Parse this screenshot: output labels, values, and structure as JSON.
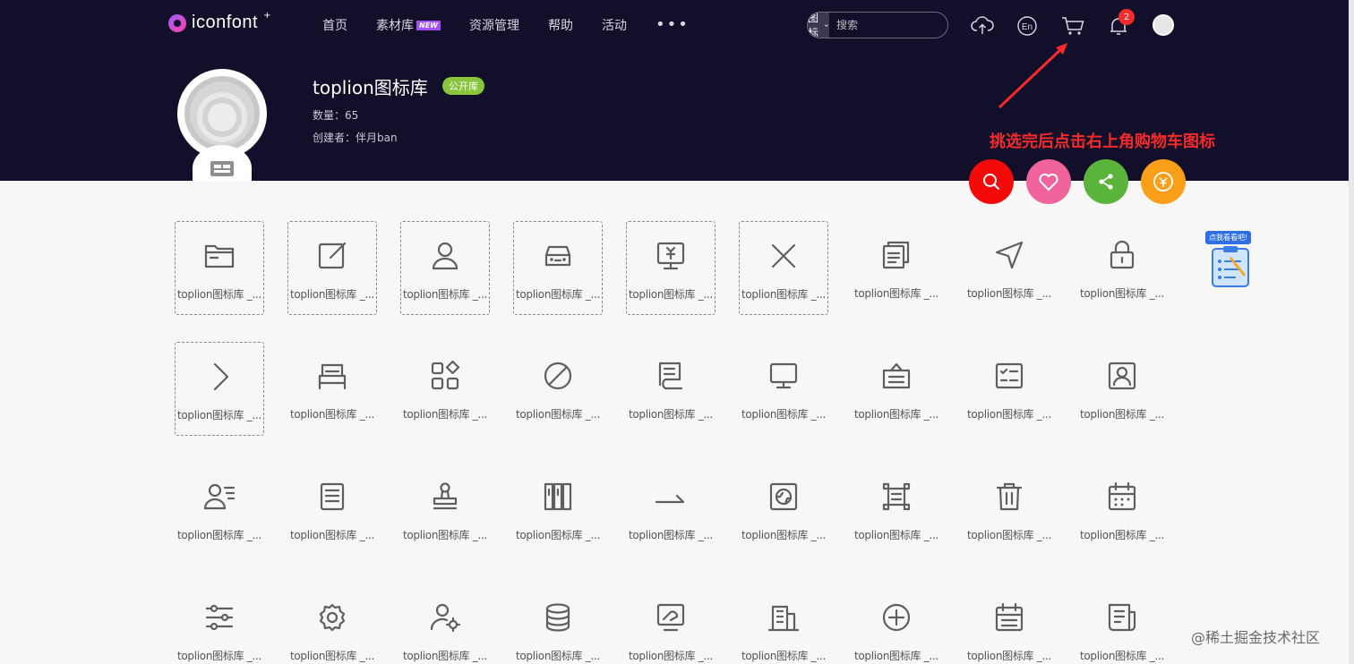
{
  "header": {
    "logo_text": "iconfont",
    "logo_star": "+",
    "nav": [
      {
        "label": "首页"
      },
      {
        "label": "素材库",
        "badge": "NEW"
      },
      {
        "label": "资源管理"
      },
      {
        "label": "帮助"
      },
      {
        "label": "活动"
      }
    ],
    "more_label": "•••",
    "search": {
      "select_label": "图标",
      "placeholder": "搜索"
    },
    "notification_count": "2"
  },
  "library": {
    "title": "toplion图标库",
    "tag": "公开库",
    "count_text": "数量：65",
    "creator_text": "创建者：伴月ban"
  },
  "annotation": {
    "text": "挑选完后点击右上角购物车图标",
    "color": "#f52a2a"
  },
  "actions": [
    {
      "name": "search",
      "color": "#f50a0a"
    },
    {
      "name": "favorite",
      "color": "#f0649b"
    },
    {
      "name": "share",
      "color": "#5ab43c"
    },
    {
      "name": "reward",
      "color": "#fa9f1a"
    }
  ],
  "icons": [
    {
      "icon": "folder",
      "label": "toplion图标库 _...",
      "selected": true
    },
    {
      "icon": "edit",
      "label": "toplion图标库 _...",
      "selected": true
    },
    {
      "icon": "user",
      "label": "toplion图标库 _...",
      "selected": true
    },
    {
      "icon": "car",
      "label": "toplion图标库 _...",
      "selected": true
    },
    {
      "icon": "money-monitor",
      "label": "toplion图标库 _...",
      "selected": true
    },
    {
      "icon": "close",
      "label": "toplion图标库 _...",
      "selected": true
    },
    {
      "icon": "document-stack",
      "label": "toplion图标库 _...",
      "selected": false
    },
    {
      "icon": "navigation",
      "label": "toplion图标库 _...",
      "selected": false
    },
    {
      "icon": "lock",
      "label": "toplion图标库 _...",
      "selected": false
    },
    {
      "icon": "chevron-right",
      "label": "toplion图标库 _...",
      "selected": true
    },
    {
      "icon": "bed",
      "label": "toplion图标库 _...",
      "selected": false
    },
    {
      "icon": "apps",
      "label": "toplion图标库 _...",
      "selected": false
    },
    {
      "icon": "forbidden",
      "label": "toplion图标库 _...",
      "selected": false
    },
    {
      "icon": "book",
      "label": "toplion图标库 _...",
      "selected": false
    },
    {
      "icon": "monitor",
      "label": "toplion图标库 _...",
      "selected": false
    },
    {
      "icon": "briefcase",
      "label": "toplion图标库 _...",
      "selected": false
    },
    {
      "icon": "checklist",
      "label": "toplion图标库 _...",
      "selected": false
    },
    {
      "icon": "contact-card",
      "label": "toplion图标库 _...",
      "selected": false
    },
    {
      "icon": "user-list",
      "label": "toplion图标库 _...",
      "selected": false
    },
    {
      "icon": "list-document",
      "label": "toplion图标库 _...",
      "selected": false
    },
    {
      "icon": "stamp",
      "label": "toplion图标库 _...",
      "selected": false
    },
    {
      "icon": "books",
      "label": "toplion图标库 _...",
      "selected": false
    },
    {
      "icon": "hook-arrow",
      "label": "toplion图标库 _...",
      "selected": false
    },
    {
      "icon": "picture",
      "label": "toplion图标库 _...",
      "selected": false
    },
    {
      "icon": "frame",
      "label": "toplion图标库 _...",
      "selected": false
    },
    {
      "icon": "trash",
      "label": "toplion图标库 _...",
      "selected": false
    },
    {
      "icon": "calendar",
      "label": "toplion图标库 _...",
      "selected": false
    },
    {
      "icon": "sliders",
      "label": "toplion图标库 _...",
      "selected": false
    },
    {
      "icon": "gear",
      "label": "toplion图标库 _...",
      "selected": false
    },
    {
      "icon": "user-settings",
      "label": "toplion图标库 _...",
      "selected": false
    },
    {
      "icon": "database",
      "label": "toplion图标库 _...",
      "selected": false
    },
    {
      "icon": "screen-chart",
      "label": "toplion图标库 _...",
      "selected": false
    },
    {
      "icon": "building",
      "label": "toplion图标库 _...",
      "selected": false
    },
    {
      "icon": "add-circle",
      "label": "toplion图标库 _...",
      "selected": false
    },
    {
      "icon": "calendar-list",
      "label": "toplion图标库 _...",
      "selected": false
    },
    {
      "icon": "news",
      "label": "toplion图标库 _...",
      "selected": false
    }
  ],
  "promo": {
    "tag": "点我看看吧!"
  },
  "watermark": "@稀土掘金技术社区"
}
